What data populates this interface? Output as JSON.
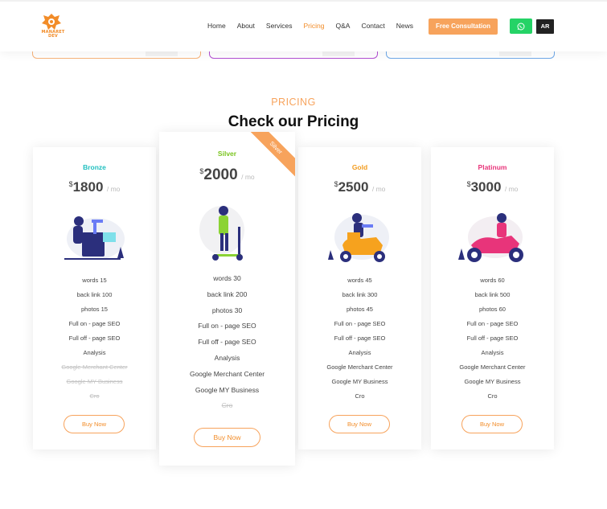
{
  "brand": {
    "logo_text": "MANARET DEV"
  },
  "nav": {
    "items": [
      {
        "label": "Home",
        "active": false
      },
      {
        "label": "About",
        "active": false
      },
      {
        "label": "Services",
        "active": false
      },
      {
        "label": "Pricing",
        "active": true
      },
      {
        "label": "Q&A",
        "active": false
      },
      {
        "label": "Contact",
        "active": false
      },
      {
        "label": "News",
        "active": false
      }
    ],
    "cta_label": "Free Consultation",
    "lang_label": "AR"
  },
  "colors": {
    "accent": "#f7a35c",
    "bronze": "#1fbfbf",
    "silver": "#7ac41f",
    "gold": "#f29c1f",
    "platinum": "#e8347a",
    "whatsapp": "#25d366"
  },
  "pricing": {
    "section_label": "PRICING",
    "section_title": "Check our Pricing",
    "plans": [
      {
        "name": "Bronze",
        "currency": "$",
        "price": "1800",
        "period": "/ mo",
        "illustration": "person-at-desk-illustration",
        "features": [
          {
            "text": "words 15",
            "included": true
          },
          {
            "text": "back link 100",
            "included": true
          },
          {
            "text": "photos 15",
            "included": true
          },
          {
            "text": "Full on - page SEO",
            "included": true
          },
          {
            "text": "Full off - page SEO",
            "included": true
          },
          {
            "text": "Analysis",
            "included": true
          },
          {
            "text": "Google Merchant Center",
            "included": false
          },
          {
            "text": "Google MY Business",
            "included": false
          },
          {
            "text": "Cro",
            "included": false
          }
        ],
        "button_label": "Buy Now"
      },
      {
        "name": "Silver",
        "currency": "$",
        "price": "2000",
        "period": "/ mo",
        "badge": "Silver",
        "illustration": "person-on-scooter-illustration",
        "features": [
          {
            "text": "words 30",
            "included": true
          },
          {
            "text": "back link 200",
            "included": true
          },
          {
            "text": "photos 30",
            "included": true
          },
          {
            "text": "Full on - page SEO",
            "included": true
          },
          {
            "text": "Full off - page SEO",
            "included": true
          },
          {
            "text": "Analysis",
            "included": true
          },
          {
            "text": "Google Merchant Center",
            "included": true
          },
          {
            "text": "Google MY Business",
            "included": true
          },
          {
            "text": "Cro",
            "included": false
          }
        ],
        "button_label": "Buy Now"
      },
      {
        "name": "Gold",
        "currency": "$",
        "price": "2500",
        "period": "/ mo",
        "illustration": "person-on-moped-illustration",
        "features": [
          {
            "text": "words 45",
            "included": true
          },
          {
            "text": "back link 300",
            "included": true
          },
          {
            "text": "photos 45",
            "included": true
          },
          {
            "text": "Full on - page SEO",
            "included": true
          },
          {
            "text": "Full off - page SEO",
            "included": true
          },
          {
            "text": "Analysis",
            "included": true
          },
          {
            "text": "Google Merchant Center",
            "included": true
          },
          {
            "text": "Google MY Business",
            "included": true
          },
          {
            "text": "Cro",
            "included": true
          }
        ],
        "button_label": "Buy Now"
      },
      {
        "name": "Platinum",
        "currency": "$",
        "price": "3000",
        "period": "/ mo",
        "illustration": "person-on-motorcycle-illustration",
        "features": [
          {
            "text": "words 60",
            "included": true
          },
          {
            "text": "back link 500",
            "included": true
          },
          {
            "text": "photos 60",
            "included": true
          },
          {
            "text": "Full on - page SEO",
            "included": true
          },
          {
            "text": "Full off - page SEO",
            "included": true
          },
          {
            "text": "Analysis",
            "included": true
          },
          {
            "text": "Google Merchant Center",
            "included": true
          },
          {
            "text": "Google MY Business",
            "included": true
          },
          {
            "text": "Cro",
            "included": true
          }
        ],
        "button_label": "Buy Now"
      }
    ]
  }
}
